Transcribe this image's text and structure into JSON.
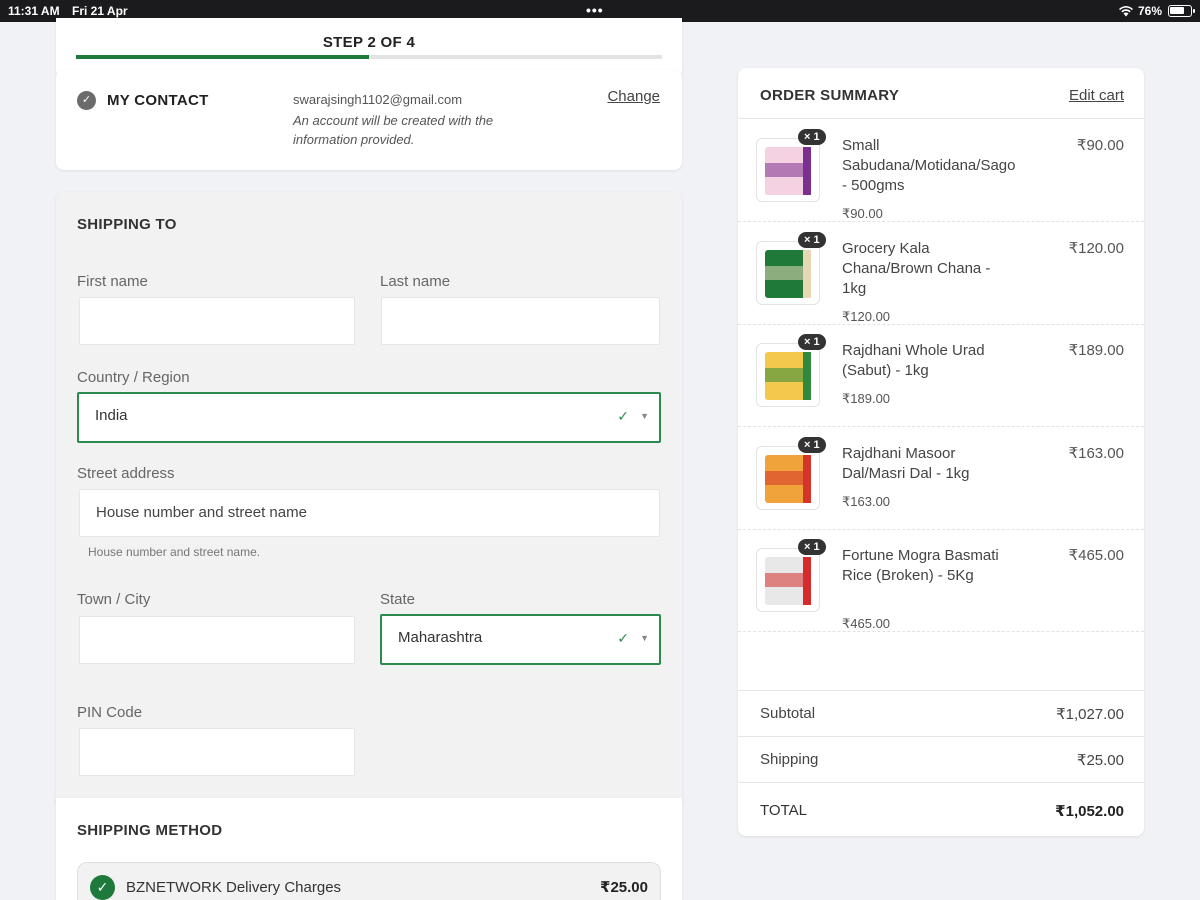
{
  "status_bar": {
    "time": "11:31 AM",
    "date": "Fri 21 Apr",
    "multitask": "•••",
    "battery": "76%",
    "battery_level": 0.76
  },
  "progress": {
    "step_label": "STEP 2 OF 4",
    "fraction": 0.5
  },
  "contact": {
    "title": "MY CONTACT",
    "email": "swarajsingh1102@gmail.com",
    "note": "An account will be created with the information provided.",
    "change_label": "Change"
  },
  "shipping": {
    "title": "SHIPPING TO",
    "first_name": {
      "label": "First name",
      "value": ""
    },
    "last_name": {
      "label": "Last name",
      "value": ""
    },
    "country": {
      "label": "Country / Region",
      "value": "India"
    },
    "street": {
      "label": "Street address",
      "placeholder": "House number and street name",
      "helper": "House number and street name."
    },
    "city": {
      "label": "Town / City",
      "value": ""
    },
    "state": {
      "label": "State",
      "value": "Maharashtra"
    },
    "pin": {
      "label": "PIN Code",
      "value": ""
    }
  },
  "shipping_method": {
    "title": "SHIPPING METHOD",
    "option_name": "BZNETWORK Delivery Charges",
    "option_price": "₹25.00"
  },
  "summary": {
    "title": "ORDER SUMMARY",
    "edit_label": "Edit cart",
    "items": [
      {
        "name": "Small Sabudana/Motidana/Sago - 500gms",
        "price": "₹90.00",
        "sub": "₹90.00",
        "qty": "× 1",
        "color": "#f4d2e2",
        "accent": "#7b2f8e"
      },
      {
        "name": "Grocery Kala Chana/Brown Chana - 1kg",
        "price": "₹120.00",
        "sub": "₹120.00",
        "qty": "× 1",
        "color": "#1f7a3a",
        "accent": "#e6d7b5"
      },
      {
        "name": "Rajdhani Whole Urad (Sabut) - 1kg",
        "price": "₹189.00",
        "sub": "₹189.00",
        "qty": "× 1",
        "color": "#f2c94c",
        "accent": "#2f8a3d"
      },
      {
        "name": "Rajdhani Masoor Dal/Masri Dal - 1kg",
        "price": "₹163.00",
        "sub": "₹163.00",
        "qty": "× 1",
        "color": "#f0a33a",
        "accent": "#d6332a"
      },
      {
        "name": "Fortune Mogra Basmati Rice (Broken) - 5Kg",
        "price": "₹465.00",
        "sub": "₹465.00",
        "qty": "× 1",
        "color": "#e8e8e8",
        "accent": "#d62b2b"
      }
    ],
    "subtotal_label": "Subtotal",
    "subtotal": "₹1,027.00",
    "shipping_label": "Shipping",
    "shipping": "₹25.00",
    "total_label": "TOTAL",
    "total": "₹1,052.00"
  },
  "colors": {
    "accent": "#1e7a3c",
    "valid_border": "#2c8a4f",
    "page_bg": "#f1f2f6"
  }
}
